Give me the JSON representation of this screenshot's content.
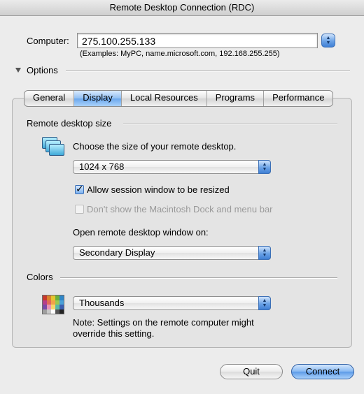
{
  "window": {
    "title": "Remote Desktop Connection (RDC)"
  },
  "computer": {
    "label": "Computer:",
    "value": "275.100.255.133",
    "examples": "(Examples: MyPC, name.microsoft.com, 192.168.255.255)"
  },
  "options": {
    "label": "Options"
  },
  "tabs": [
    {
      "label": "General",
      "active": false
    },
    {
      "label": "Display",
      "active": true
    },
    {
      "label": "Local Resources",
      "active": false
    },
    {
      "label": "Programs",
      "active": false
    },
    {
      "label": "Performance",
      "active": false
    }
  ],
  "display": {
    "size_section": "Remote desktop size",
    "size_prompt": "Choose the size of your remote desktop.",
    "size_value": "1024 x 768",
    "allow_resize": {
      "label": "Allow session window to be resized",
      "checked": true
    },
    "hide_dock": {
      "label": "Don't show the Macintosh Dock and menu bar",
      "checked": false,
      "enabled": false
    },
    "open_on_label": "Open remote desktop window on:",
    "open_on_value": "Secondary Display",
    "colors_section": "Colors",
    "colors_value": "Thousands",
    "note": "Note: Settings on the remote computer might override this setting."
  },
  "buttons": {
    "quit": "Quit",
    "connect": "Connect"
  },
  "icons": {
    "display_icon": "monitors-icon",
    "colors_icon": "color-palette-icon"
  },
  "palette_colors": [
    "#c8392e",
    "#d9822b",
    "#e5c52f",
    "#6bb13c",
    "#2f86c8",
    "#b63f8a",
    "#e06a5a",
    "#f2a24a",
    "#9bc94f",
    "#4aa0d8",
    "#7b4aa8",
    "#e891b6",
    "#f5d56b",
    "#5ab8a8",
    "#3c5fb0",
    "#9f9f9f",
    "#c8c8c8",
    "#ffffff",
    "#555555",
    "#222222"
  ]
}
